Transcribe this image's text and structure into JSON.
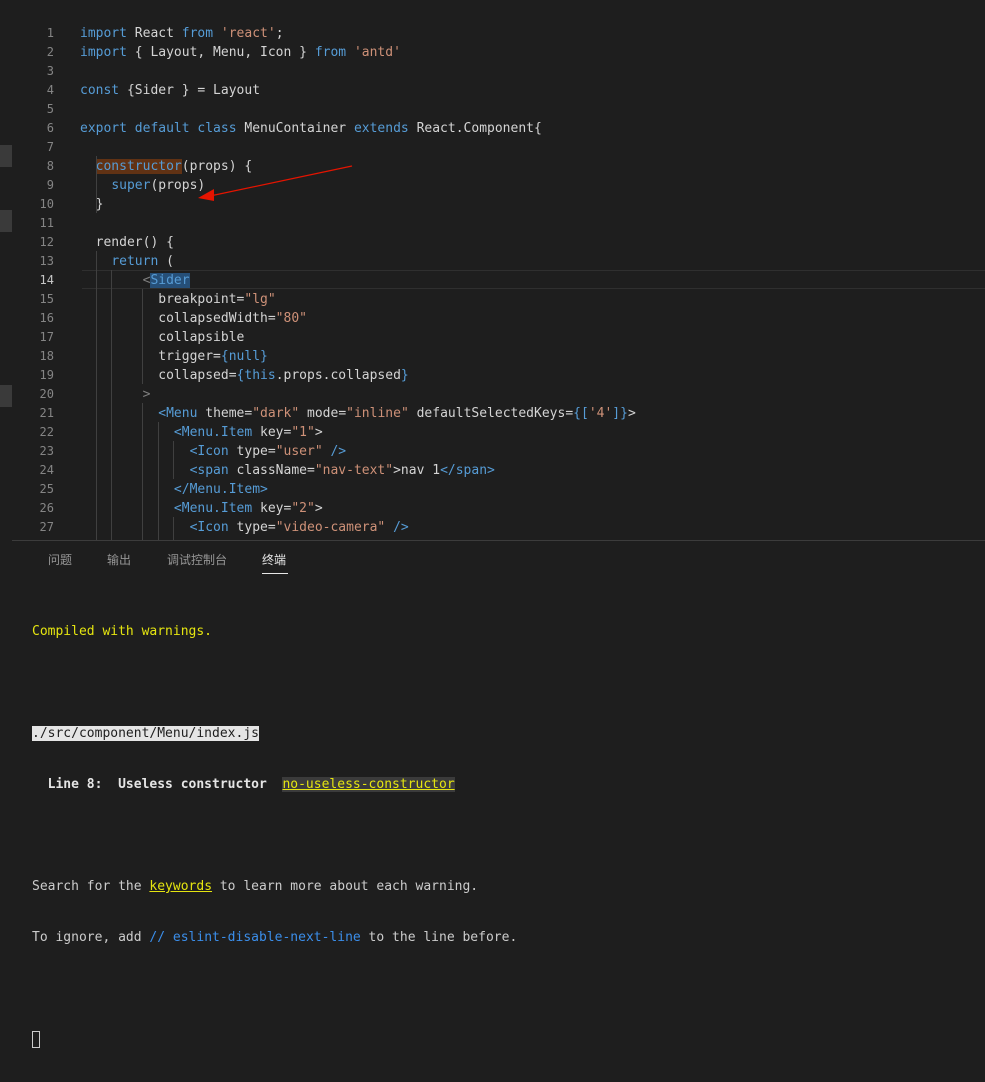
{
  "editor": {
    "active_line": 14,
    "lines": [
      {
        "n": "1",
        "tokens": [
          {
            "t": "import",
            "c": "kw"
          },
          {
            "t": " React ",
            "c": "plain"
          },
          {
            "t": "from",
            "c": "kw"
          },
          {
            "t": " ",
            "c": "plain"
          },
          {
            "t": "'react'",
            "c": "str"
          },
          {
            "t": ";",
            "c": "plain"
          }
        ]
      },
      {
        "n": "2",
        "tokens": [
          {
            "t": "import",
            "c": "kw"
          },
          {
            "t": " { Layout, Menu, Icon } ",
            "c": "plain"
          },
          {
            "t": "from",
            "c": "kw"
          },
          {
            "t": " ",
            "c": "plain"
          },
          {
            "t": "'antd'",
            "c": "str"
          }
        ]
      },
      {
        "n": "3",
        "tokens": []
      },
      {
        "n": "4",
        "tokens": [
          {
            "t": "const",
            "c": "kw"
          },
          {
            "t": " {Sider } = Layout",
            "c": "plain"
          }
        ]
      },
      {
        "n": "5",
        "tokens": []
      },
      {
        "n": "6",
        "tokens": [
          {
            "t": "export default class",
            "c": "kw"
          },
          {
            "t": " MenuContainer ",
            "c": "plain"
          },
          {
            "t": "extends",
            "c": "kw"
          },
          {
            "t": " React.Component{",
            "c": "plain"
          }
        ]
      },
      {
        "n": "7",
        "tokens": []
      },
      {
        "n": "8",
        "tokens": [
          {
            "t": "  ",
            "c": "plain"
          },
          {
            "t": "constructor",
            "c": "kw hl"
          },
          {
            "t": "(props) {",
            "c": "plain"
          }
        ]
      },
      {
        "n": "9",
        "tokens": [
          {
            "t": "    ",
            "c": "plain"
          },
          {
            "t": "super",
            "c": "kw"
          },
          {
            "t": "(props)",
            "c": "plain"
          }
        ]
      },
      {
        "n": "10",
        "tokens": [
          {
            "t": "  }",
            "c": "plain"
          }
        ]
      },
      {
        "n": "11",
        "tokens": []
      },
      {
        "n": "12",
        "tokens": [
          {
            "t": "  render() {",
            "c": "plain"
          }
        ]
      },
      {
        "n": "13",
        "tokens": [
          {
            "t": "    ",
            "c": "plain"
          },
          {
            "t": "return",
            "c": "kw"
          },
          {
            "t": " (",
            "c": "plain"
          }
        ]
      },
      {
        "n": "14",
        "tokens": [
          {
            "t": "        ",
            "c": "plain"
          },
          {
            "t": "<",
            "c": "punc"
          },
          {
            "t": "Sider",
            "c": "tag sel"
          }
        ]
      },
      {
        "n": "15",
        "tokens": [
          {
            "t": "          breakpoint=",
            "c": "plain"
          },
          {
            "t": "\"lg\"",
            "c": "str"
          }
        ]
      },
      {
        "n": "16",
        "tokens": [
          {
            "t": "          collapsedWidth=",
            "c": "plain"
          },
          {
            "t": "\"80\"",
            "c": "str"
          }
        ]
      },
      {
        "n": "17",
        "tokens": [
          {
            "t": "          collapsible",
            "c": "plain"
          }
        ]
      },
      {
        "n": "18",
        "tokens": [
          {
            "t": "          trigger=",
            "c": "plain"
          },
          {
            "t": "{null}",
            "c": "kw"
          }
        ]
      },
      {
        "n": "19",
        "tokens": [
          {
            "t": "          collapsed=",
            "c": "plain"
          },
          {
            "t": "{",
            "c": "kw"
          },
          {
            "t": "this",
            "c": "kw"
          },
          {
            "t": ".props.collapsed",
            "c": "plain"
          },
          {
            "t": "}",
            "c": "kw"
          }
        ]
      },
      {
        "n": "20",
        "tokens": [
          {
            "t": "        ",
            "c": "plain"
          },
          {
            "t": ">",
            "c": "punc"
          }
        ]
      },
      {
        "n": "21",
        "tokens": [
          {
            "t": "          ",
            "c": "plain"
          },
          {
            "t": "<Menu",
            "c": "tag"
          },
          {
            "t": " theme=",
            "c": "plain"
          },
          {
            "t": "\"dark\"",
            "c": "str"
          },
          {
            "t": " mode=",
            "c": "plain"
          },
          {
            "t": "\"inline\"",
            "c": "str"
          },
          {
            "t": " defaultSelectedKeys=",
            "c": "plain"
          },
          {
            "t": "{[",
            "c": "kw"
          },
          {
            "t": "'4'",
            "c": "str"
          },
          {
            "t": "]}",
            "c": "kw"
          },
          {
            "t": ">",
            "c": "plain"
          }
        ]
      },
      {
        "n": "22",
        "tokens": [
          {
            "t": "            ",
            "c": "plain"
          },
          {
            "t": "<Menu.Item",
            "c": "tag"
          },
          {
            "t": " key=",
            "c": "plain"
          },
          {
            "t": "\"1\"",
            "c": "str"
          },
          {
            "t": ">",
            "c": "plain"
          }
        ]
      },
      {
        "n": "23",
        "tokens": [
          {
            "t": "              ",
            "c": "plain"
          },
          {
            "t": "<Icon",
            "c": "tag"
          },
          {
            "t": " type=",
            "c": "plain"
          },
          {
            "t": "\"user\"",
            "c": "str"
          },
          {
            "t": " />",
            "c": "tag"
          }
        ]
      },
      {
        "n": "24",
        "tokens": [
          {
            "t": "              ",
            "c": "plain"
          },
          {
            "t": "<span",
            "c": "tag"
          },
          {
            "t": " className=",
            "c": "plain"
          },
          {
            "t": "\"nav-text\"",
            "c": "str"
          },
          {
            "t": ">nav 1",
            "c": "plain"
          },
          {
            "t": "</span>",
            "c": "tag"
          }
        ]
      },
      {
        "n": "25",
        "tokens": [
          {
            "t": "            ",
            "c": "plain"
          },
          {
            "t": "</Menu.Item>",
            "c": "tag"
          }
        ]
      },
      {
        "n": "26",
        "tokens": [
          {
            "t": "            ",
            "c": "plain"
          },
          {
            "t": "<Menu.Item",
            "c": "tag"
          },
          {
            "t": " key=",
            "c": "plain"
          },
          {
            "t": "\"2\"",
            "c": "str"
          },
          {
            "t": ">",
            "c": "plain"
          }
        ]
      },
      {
        "n": "27",
        "tokens": [
          {
            "t": "              ",
            "c": "plain"
          },
          {
            "t": "<Icon",
            "c": "tag"
          },
          {
            "t": " type=",
            "c": "plain"
          },
          {
            "t": "\"video-camera\"",
            "c": "str"
          },
          {
            "t": " />",
            "c": "tag"
          }
        ]
      }
    ]
  },
  "panel": {
    "tabs": [
      {
        "label": "问题",
        "active": false
      },
      {
        "label": "输出",
        "active": false
      },
      {
        "label": "调试控制台",
        "active": false
      },
      {
        "label": "终端",
        "active": true
      }
    ]
  },
  "terminal": {
    "compiled": "Compiled with warnings.",
    "file_path": "./src/component/Menu/index.js",
    "warning_prefix": "  Line 8:  Useless constructor  ",
    "warning_rule": "no-useless-constructor",
    "search_pre": "Search for the ",
    "search_kw": "keywords",
    "search_post": " to learn more about each warning.",
    "ignore_pre": "To ignore, add ",
    "ignore_code": "// eslint-disable-next-line",
    "ignore_post": " to the line before."
  },
  "colors": {
    "background": "#1e1e1e",
    "keyword": "#569cd6",
    "string": "#ce9178",
    "warning_yellow": "#e5e510",
    "annotation_arrow": "#e51400"
  },
  "icons": [
    "cursor-block-icon"
  ]
}
